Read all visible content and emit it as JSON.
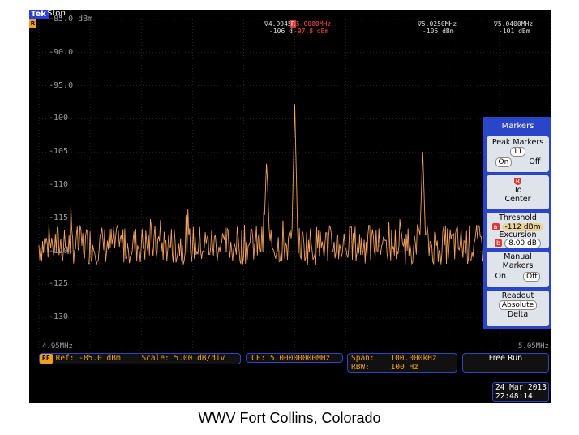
{
  "header": {
    "brand": "Tek",
    "status": "Stop",
    "ref_corner": "R"
  },
  "chart_data": {
    "type": "line",
    "x_range_mhz": [
      4.95,
      5.05
    ],
    "ylim": [
      -135,
      -85
    ],
    "y_tick_labels": [
      "-85.0 dBm",
      "-90.0",
      "-95.0",
      "-100",
      "-105",
      "-110",
      "-115",
      "-120",
      "-125",
      "-130"
    ],
    "y_tick_values": [
      -85,
      -90,
      -95,
      -100,
      -105,
      -110,
      -115,
      -120,
      -125,
      -130
    ],
    "x_start_label": "4.95MHz",
    "x_end_label": "5.05MHz",
    "noise_floor_dbm": -119,
    "peaks": [
      {
        "freq_mhz": 4.9945,
        "level_dbm": -106
      },
      {
        "freq_mhz": 5.0,
        "level_dbm": -97.8
      },
      {
        "freq_mhz": 5.025,
        "level_dbm": -105
      },
      {
        "freq_mhz": 5.04,
        "level_dbm": -101
      }
    ]
  },
  "markers": [
    {
      "freq": "4.9945",
      "level": "-106 d",
      "is_ref": false
    },
    {
      "freq": "5.0000MHz",
      "level": "-97.8 dBm",
      "is_ref": true,
      "ref_symbol": "R"
    },
    {
      "freq": "5.0250MHz",
      "level": "-105 dBm",
      "is_ref": false
    },
    {
      "freq": "5.0400MHz",
      "level": "-101 dBm",
      "is_ref": false
    }
  ],
  "marker_glyph": "∇",
  "bottom_bar": {
    "rf_tag": "RF",
    "ref": "Ref: -85.0 dBm",
    "scale": "Scale: 5.00 dB/div",
    "cf": "CF: 5.00000000MHz",
    "span_label": "Span:",
    "span_value": "100.000kHz",
    "rbw_label": "RBW:",
    "rbw_value": "100 Hz",
    "run_mode": "Free Run"
  },
  "datetime": {
    "date": "24 Mar 2013",
    "time": "22:48:14"
  },
  "menu": {
    "title": "Markers",
    "peak_markers": {
      "label": "Peak Markers",
      "count": "11",
      "on": "On",
      "off": "Off"
    },
    "to_center": {
      "symbol": "R",
      "line1": "To",
      "line2": "Center"
    },
    "threshold": {
      "label": "Threshold",
      "tag": "a",
      "value": "-112 dBm"
    },
    "excursion": {
      "label": "Excursion",
      "tag": "b",
      "value": "8.00 dB"
    },
    "manual_markers": {
      "line1": "Manual",
      "line2": "Markers",
      "on": "On",
      "off": "Off"
    },
    "readout": {
      "label": "Readout",
      "absolute": "Absolute",
      "delta": "Delta"
    }
  },
  "caption": "WWV Fort Collins, Colorado",
  "colors": {
    "trace": "#f0a060",
    "grid": "#3a3a3a",
    "menu_bg": "#2a45c8",
    "accent": "#f0a020"
  }
}
